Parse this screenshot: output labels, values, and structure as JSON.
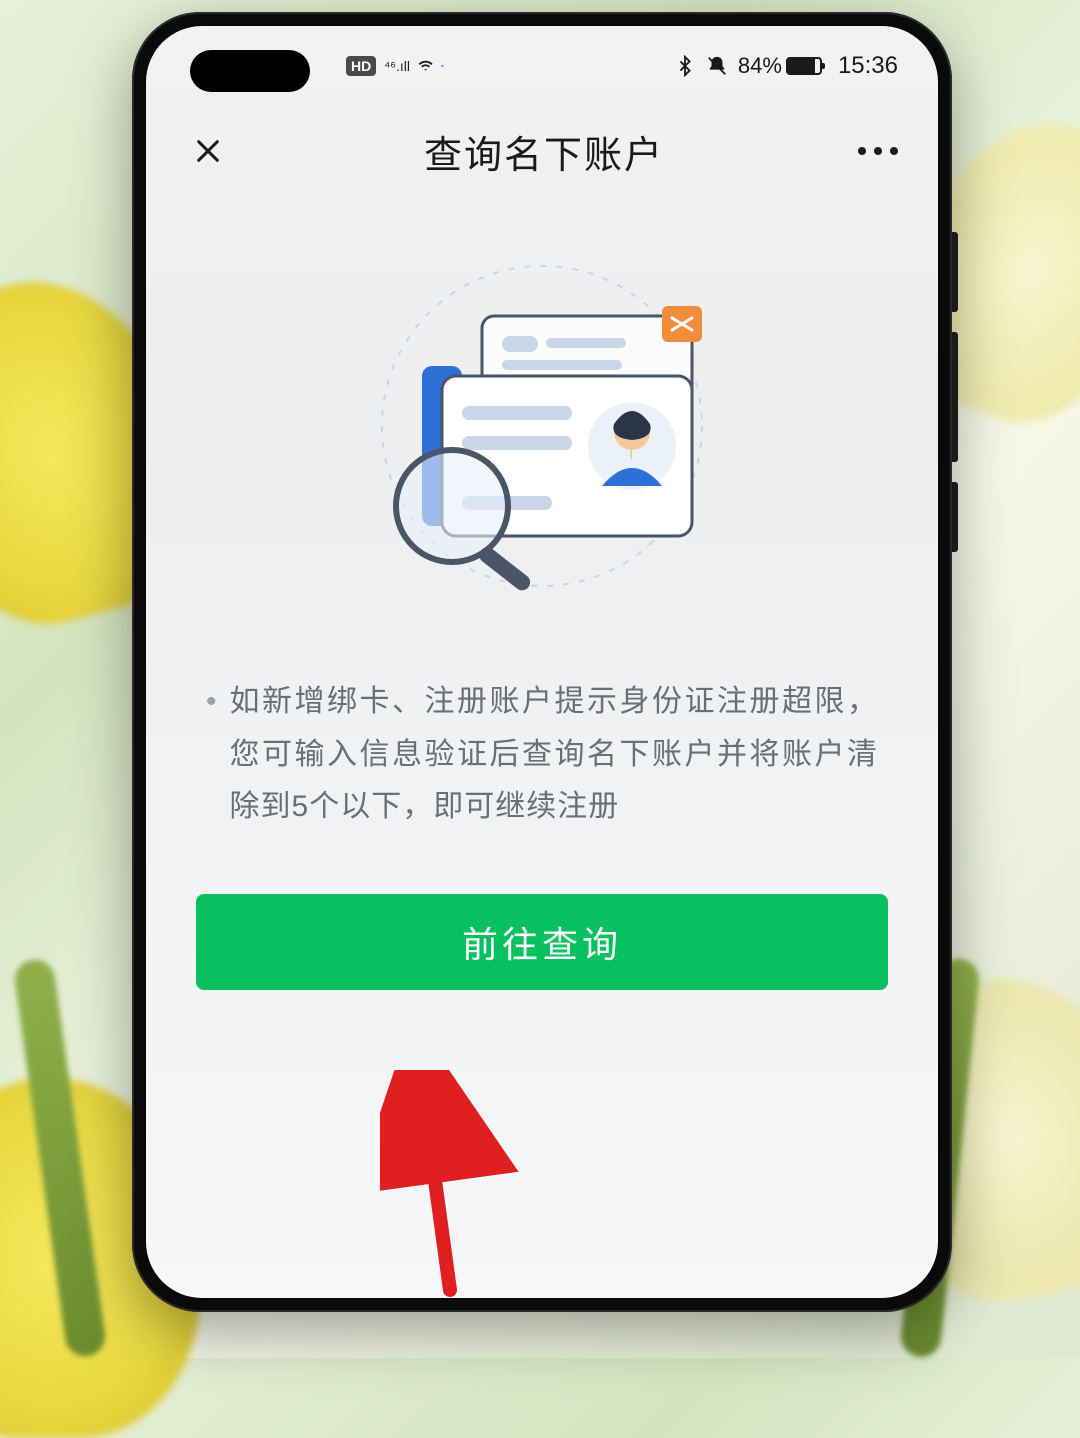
{
  "status_bar": {
    "hd_label": "HD",
    "network_label": "⁴⁶.ıll",
    "battery_percent_text": "84%",
    "battery_percent": 84,
    "time": "15:36"
  },
  "nav": {
    "title": "查询名下账户"
  },
  "content": {
    "bullet": "•",
    "info_text": "如新增绑卡、注册账户提示身份证注册超限，您可输入信息验证后查询名下账户并将账户清除到5个以下，即可继续注册",
    "button_label": "前往查询"
  },
  "colors": {
    "primary": "#07c160",
    "text_secondary": "#6a6e76",
    "arrow": "#e02020"
  }
}
